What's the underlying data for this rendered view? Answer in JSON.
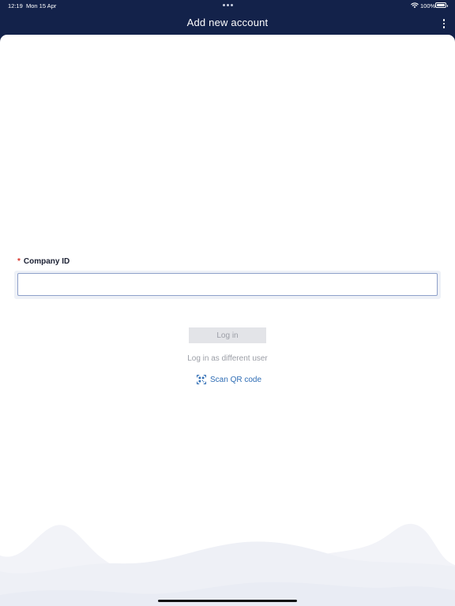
{
  "status_bar": {
    "time": "12:19",
    "date": "Mon 15 Apr",
    "battery": "100%"
  },
  "nav": {
    "title": "Add new account"
  },
  "form": {
    "company_label": "Company ID",
    "required_marker": "*",
    "company_value": "",
    "company_placeholder": ""
  },
  "actions": {
    "login_label": "Log in",
    "different_user_label": "Log in as different user",
    "scan_qr_label": "Scan QR code"
  },
  "colors": {
    "header_bg": "#13224a",
    "accent_link": "#2f6db5",
    "required": "#d9342b",
    "disabled_button_bg": "#e3e4e8"
  },
  "icons": [
    "wifi-icon",
    "battery-icon",
    "more-vertical-icon",
    "qr-code-scan-icon"
  ]
}
